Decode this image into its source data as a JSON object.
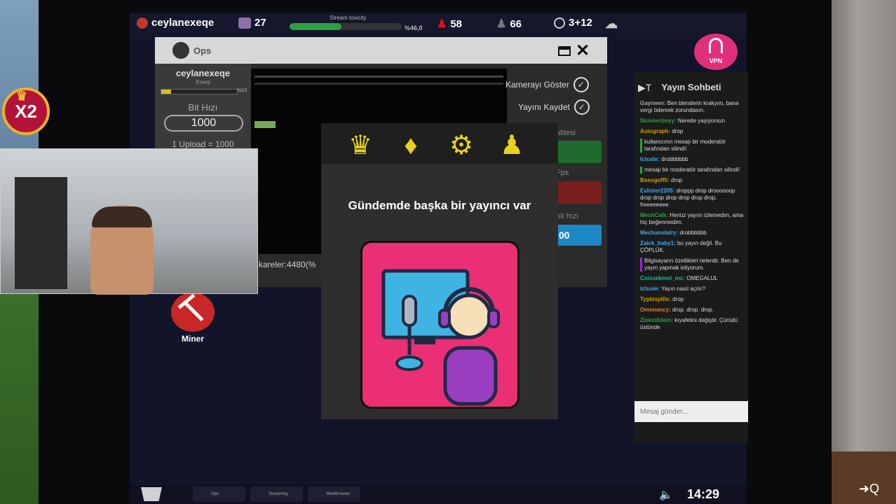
{
  "topbar": {
    "username": "ceylanexeqe",
    "followers": "27",
    "toxicity_label": "Stream toxicity",
    "toxicity_percent": "%46,0",
    "toxicity_value": 0.46,
    "stat_red": "58",
    "stat_gray": "66",
    "timer": "3+12"
  },
  "stream_window": {
    "title": "Ops",
    "user": "ceylanexeqe",
    "energy_label": "Enerji",
    "energy_percent": "%13",
    "energy_value": 0.13,
    "bitrate_label": "Bit Hızı",
    "bitrate_value": "1000",
    "upload_text": "1 Upload = 1000",
    "frames_text": "kareler:4480(%",
    "show_camera": "Kamerayı Göster",
    "save_stream": "Yayını Kaydet",
    "quality_label": "alitesi",
    "fps_label": "Fps",
    "bitrate_right_label": "bit hızı",
    "bitrate_right_value": "00"
  },
  "modal": {
    "icons": [
      "jester-icon",
      "bird-icon",
      "gear-icon",
      "user-icon"
    ],
    "message": "Gündemde başka bir yayıncı var"
  },
  "chat": {
    "title": "Yayın Sohbeti",
    "placeholder": "Mesaj gönder...",
    "messages": [
      {
        "user": "Gayrwen:",
        "text": "Ben blenderin krakyım, bana vergi ödemek zorundasın.",
        "color": "#aaaaaa"
      },
      {
        "user": "Stunnerboyy:",
        "text": "Nerede yaşıyorsun",
        "color": "#2ea043"
      },
      {
        "user": "Autograph:",
        "text": "drop",
        "color": "#c8a000"
      },
      {
        "user": "",
        "text": "kullanıcının mesajı bir moderatör tarafından silindi!",
        "color": "#2ea043"
      },
      {
        "user": "lctusle:",
        "text": "drobbbbbb",
        "color": "#3fa9f5"
      },
      {
        "user": "",
        "text": "mesajı bir moderatör tarafından silindi!",
        "color": "#2ea043"
      },
      {
        "user": "Basogoffli:",
        "text": "drop",
        "color": "#c8a000"
      },
      {
        "user": "Exlister2205:",
        "text": "droppp drop droooooop drop drop drop drop drop drop. freeeeeeee",
        "color": "#3fa9f5"
      },
      {
        "user": "MeshCalk:",
        "text": "Henüz yayını izlemedim, ama hiç beğenmedim.",
        "color": "#2ea043"
      },
      {
        "user": "Mechanolatry:",
        "text": "drobbbbbb",
        "color": "#3fa9f5"
      },
      {
        "user": "Zaick_baby1:",
        "text": "bu yayın değil. Bu ÇÖPLÜK.",
        "color": "#3fa9f5"
      },
      {
        "user": "",
        "text": "Bilgisayarın özellikleri nelerdir. Ben de yayın yapmak istiyorum.",
        "color": "#a020f0"
      },
      {
        "user": "Coissekmot_mc:",
        "text": "OMEGALUL",
        "color": "#1abc9c"
      },
      {
        "user": "lctusle:",
        "text": "Yayın nasıl açılır?",
        "color": "#3fa9f5"
      },
      {
        "user": "Typhisplile:",
        "text": "drop",
        "color": "#c8a000"
      },
      {
        "user": "Omenancy:",
        "text": "drop. drop. drop.",
        "color": "#e67e22"
      },
      {
        "user": "Ziokmlblem:",
        "text": "kıyafetini değiştir. Çürüdü üstünde",
        "color": "#2ea043"
      }
    ]
  },
  "vpn_label": "VPN",
  "miner_label": "Miner",
  "badge": "X2",
  "taskbar": {
    "apps": [
      "Ops",
      "Streaming",
      "WebBrowser"
    ],
    "clock": "14:29"
  },
  "colors": {
    "accent_pink": "#ea2f74",
    "toxicity_green": "#2ea043",
    "icon_yellow": "#e8d21d"
  }
}
